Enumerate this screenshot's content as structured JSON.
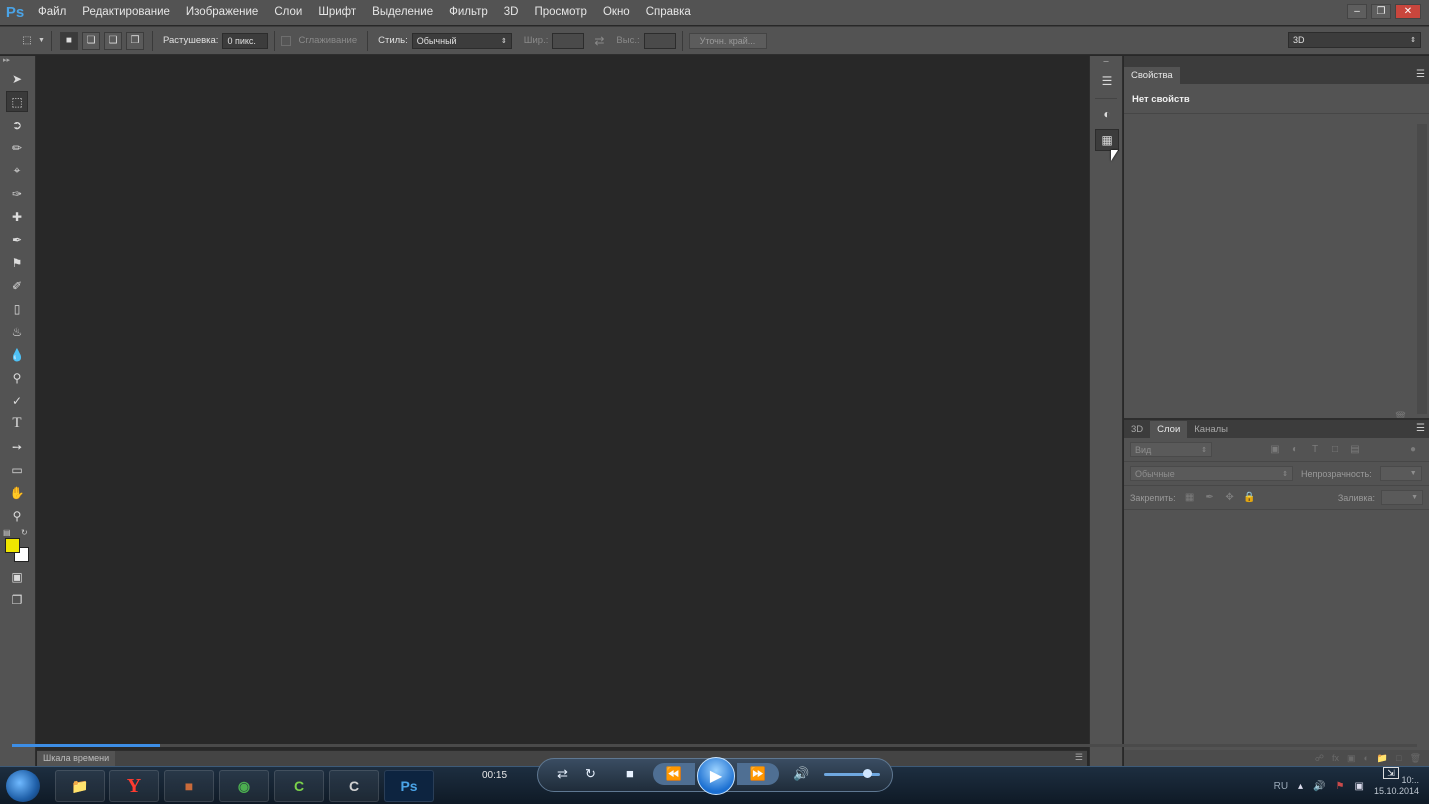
{
  "app": {
    "logo": "Ps"
  },
  "menu": [
    "Файл",
    "Редактирование",
    "Изображение",
    "Слои",
    "Шрифт",
    "Выделение",
    "Фильтр",
    "3D",
    "Просмотр",
    "Окно",
    "Справка"
  ],
  "options": {
    "feather_label": "Растушевка:",
    "feather_value": "0 пикс.",
    "antialias_label": "Сглаживание",
    "style_label": "Стиль:",
    "style_value": "Обычный",
    "width_label": "Шир.:",
    "height_label": "Выс.:",
    "refine_label": "Уточн. край...",
    "workspace_value": "3D"
  },
  "tools": {
    "foreground_color": "#f0e600",
    "background_color": "#ffffff"
  },
  "properties": {
    "tab": "Свойства",
    "title": "Нет свойств"
  },
  "layers": {
    "tabs": [
      "3D",
      "Слои",
      "Каналы"
    ],
    "active_tab": "Слои",
    "filter_placeholder": "Вид",
    "blend_mode": "Обычные",
    "opacity_label": "Непрозрачность:",
    "lock_label": "Закрепить:",
    "fill_label": "Заливка:"
  },
  "timeline": {
    "tab": "Шкала времени"
  },
  "player": {
    "elapsed": "00:15",
    "progress": 0.105
  },
  "taskbar": {
    "apps": [
      "explorer",
      "yandex-browser",
      "game",
      "chrome",
      "camtasia-1",
      "camtasia-2",
      "photoshop"
    ],
    "language": "RU",
    "time": "10:..",
    "date": "15.10.2014"
  }
}
